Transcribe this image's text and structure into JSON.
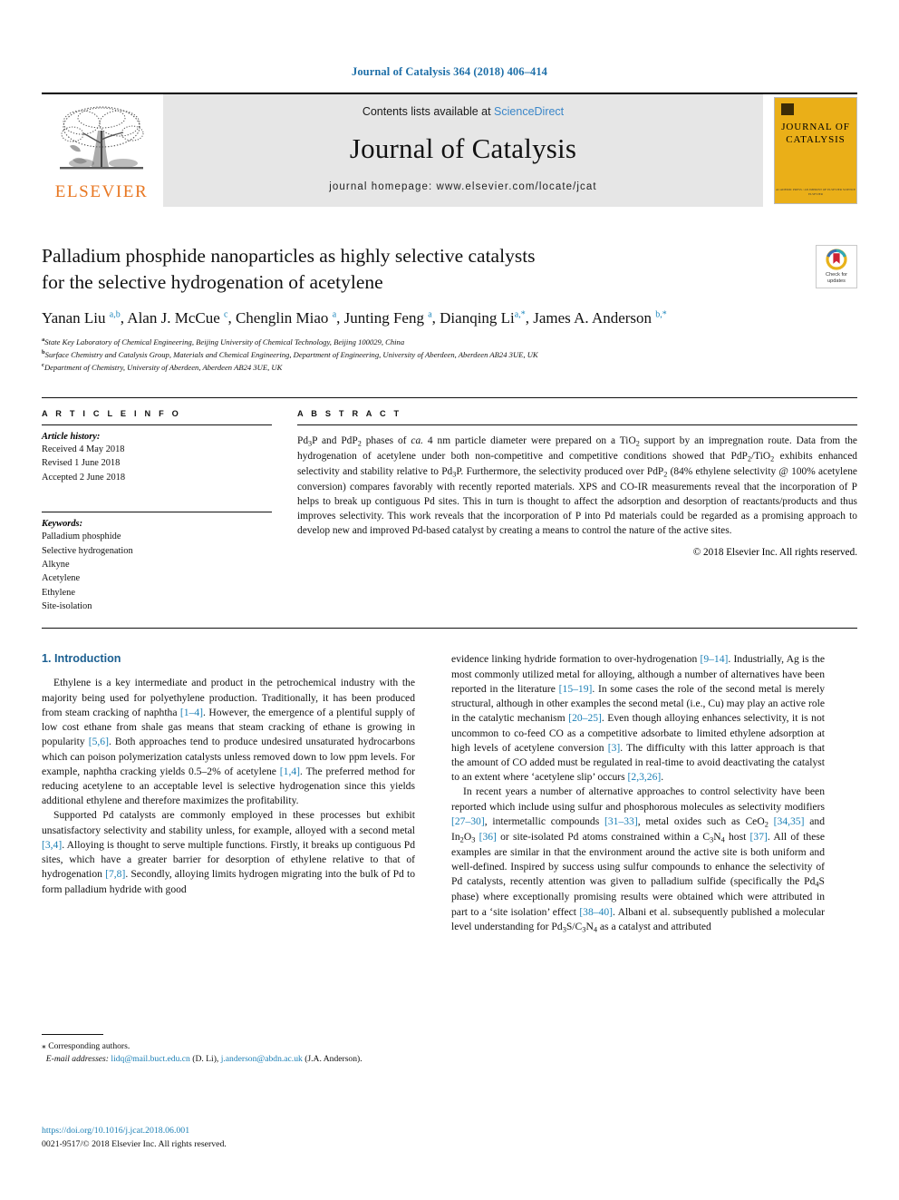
{
  "running_head": "Journal of Catalysis 364 (2018) 406–414",
  "masthead": {
    "publisher_name": "ELSEVIER",
    "publisher_logo_icon": "elsevier-tree-logo",
    "contents_prefix": "Contents lists available at ",
    "contents_link": "ScienceDirect",
    "journal_name": "Journal of Catalysis",
    "homepage": "journal homepage: www.elsevier.com/locate/jcat",
    "cover": {
      "line1": "JOURNAL OF",
      "line2": "CATALYSIS",
      "footer1": "ACADEMIC PRESS / AN IMPRINT OF ELSEVIER SCIENCE",
      "footer2": "ELSEVIER"
    }
  },
  "article": {
    "title_line1": "Palladium phosphide nanoparticles as highly selective catalysts",
    "title_line2": "for the selective hydrogenation of acetylene",
    "crossmark_label_line1": "Check for",
    "crossmark_label_line2": "updates",
    "authors": [
      {
        "name": "Yanan Liu",
        "marks": "a,b"
      },
      {
        "name": "Alan J. McCue",
        "marks": "c"
      },
      {
        "name": "Chenglin Miao",
        "marks": "a"
      },
      {
        "name": "Junting Feng",
        "marks": "a"
      },
      {
        "name": "Dianqing Li",
        "marks": "a,*"
      },
      {
        "name": "James A. Anderson",
        "marks": "b,*"
      }
    ],
    "affiliations": [
      {
        "mark": "a",
        "text": "State Key Laboratory of Chemical Engineering, Beijing University of Chemical Technology, Beijing 100029, China"
      },
      {
        "mark": "b",
        "text": "Surface Chemistry and Catalysis Group, Materials and Chemical Engineering, Department of Engineering, University of Aberdeen, Aberdeen AB24 3UE, UK"
      },
      {
        "mark": "c",
        "text": "Department of Chemistry, University of Aberdeen, Aberdeen AB24 3UE, UK"
      }
    ]
  },
  "article_info": {
    "heading": "A R T I C L E   I N F O",
    "history_label": "Article history:",
    "history": [
      "Received 4 May 2018",
      "Revised 1 June 2018",
      "Accepted 2 June 2018"
    ],
    "keywords_label": "Keywords:",
    "keywords": [
      "Palladium phosphide",
      "Selective hydrogenation",
      "Alkyne",
      "Acetylene",
      "Ethylene",
      "Site-isolation"
    ]
  },
  "abstract": {
    "heading": "A B S T R A C T",
    "copyright": "© 2018 Elsevier Inc. All rights reserved."
  },
  "introduction": {
    "heading": "1. Introduction"
  },
  "footnote": {
    "corresponding": "⁎ Corresponding authors.",
    "email_label": "E-mail addresses:",
    "email1": "lidq@mail.buct.edu.cn",
    "email1_owner": "(D. Li),",
    "email2": "j.anderson@abdn.ac.uk",
    "email2_owner": "(J.A. Anderson)."
  },
  "doi": {
    "url": "https://doi.org/10.1016/j.jcat.2018.06.001",
    "issn_copyright": "0021-9517/© 2018 Elsevier Inc. All rights reserved."
  },
  "colors": {
    "link_blue": "#1b7fb5",
    "heading_blue": "#1b5f91",
    "elsevier_orange": "#e87722",
    "cover_yellow": "#eaaf18"
  }
}
